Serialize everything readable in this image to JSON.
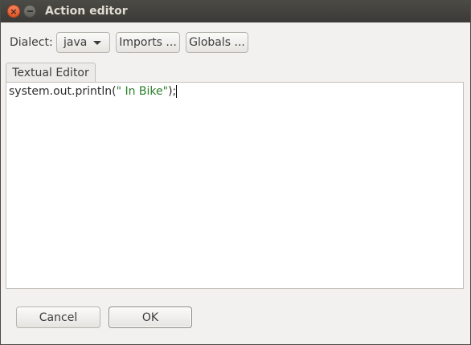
{
  "window": {
    "title": "Action editor"
  },
  "toolbar": {
    "dialect_label": "Dialect:",
    "dialect_value": "java",
    "imports_label": "Imports ...",
    "globals_label": "Globals ..."
  },
  "tabs": [
    {
      "label": "Textual Editor",
      "active": true
    }
  ],
  "editor": {
    "code_prefix": "system.out.println(",
    "code_string": "\" In Bike\"",
    "code_suffix": ");"
  },
  "footer": {
    "cancel_label": "Cancel",
    "ok_label": "OK"
  },
  "colors": {
    "titlebar": "#3c3b37",
    "close_button": "#e95420",
    "string_literal": "#2a7f2a"
  }
}
